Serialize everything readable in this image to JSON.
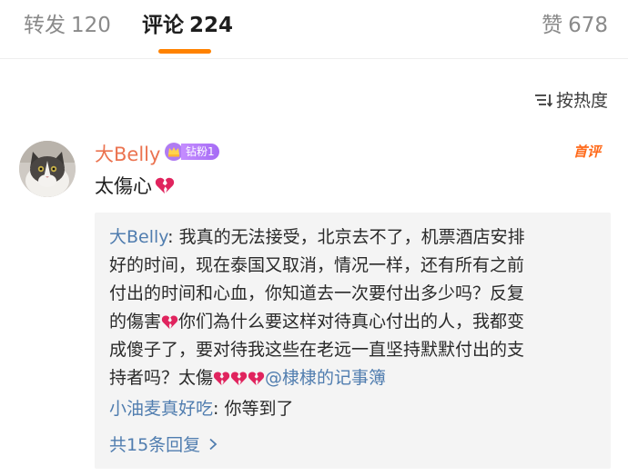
{
  "tabs": {
    "repost": {
      "label": "转发",
      "count": "120"
    },
    "comments": {
      "label": "评论",
      "count": "224"
    },
    "likes": {
      "label": "赞",
      "count": "678"
    }
  },
  "sort": {
    "label": "按热度"
  },
  "comment": {
    "username": "大Belly",
    "badge": "钻粉1",
    "tag": "首评",
    "text": "太傷心"
  },
  "replies": {
    "reply1": {
      "author": "大Belly",
      "lines": [
        "我真的无法接受，北京去不了，机票酒店安排",
        "好的时间，现在泰国又取消，情况一样，还有所有之前",
        "付出的时间和心血，你知道去一次要付出多少吗？反复",
        "的傷害",
        "你们為什么要这样对待真心付出的人，我都变",
        "成傻子了，要对待我这些在老远一直坚持默默付出的支",
        "持者吗？太傷"
      ],
      "mention": "@棣棣的记事簿"
    },
    "reply2": {
      "author": "小油麦真好吃",
      "text": "你等到了"
    },
    "more_label": "共15条回复"
  },
  "colors": {
    "accent": "#ff8200",
    "username": "#eb7350",
    "link": "#507daf",
    "heart": "#e0245e"
  }
}
